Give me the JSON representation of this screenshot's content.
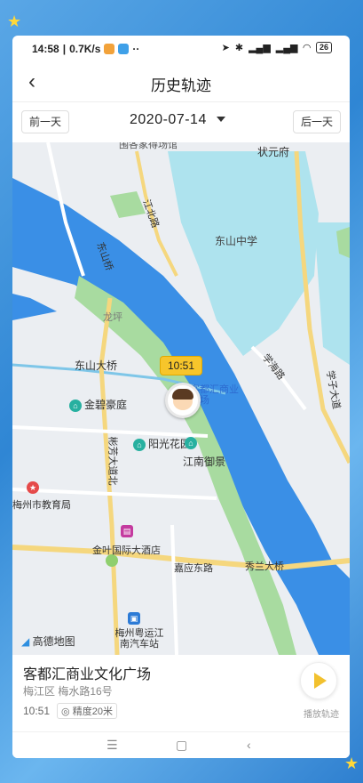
{
  "status": {
    "time": "14:58",
    "speed": "0.7K/s",
    "battery": "26"
  },
  "header": {
    "back_glyph": "‹",
    "title": "历史轨迹"
  },
  "datebar": {
    "prev": "前一天",
    "date": "2020-07-14",
    "next": "后一天"
  },
  "map": {
    "labels": {
      "dongshan_school": "东山中学",
      "zhuangyuanfu": "状元府",
      "jiangbin_road": "江北路",
      "dongshan_bridge_n": "东山桥",
      "dongshan_bridge": "东山大桥",
      "longping": "龙坪",
      "xuehai_road": "学海路",
      "xuezi_ave": "学子大道",
      "jinbihaoting": "金碧豪庭",
      "kedouhui": "客都汇商业广场",
      "biaoqi_ave": "彬芳大道北",
      "yangguang": "阳光花园",
      "jiangnan": "江南御景",
      "education_bureau": "梅州市教育局",
      "jinye_hotel": "金叶国际大酒店",
      "jiayingdong_road": "嘉应东路",
      "xiulan_bridge": "秀兰大桥",
      "bus_station": "梅州粤运江南汽车站",
      "top_partial": "围各家得场馆"
    },
    "time_badge": "10:51",
    "logo": "高德地图",
    "colors": {
      "river": "#3a8fe6",
      "lake": "#aee3ee",
      "road": "#f5d77e",
      "green": "#a8dba0"
    }
  },
  "info": {
    "place": "客都汇商业文化广场",
    "address": "梅江区 梅水路16号",
    "time": "10:51",
    "accuracy": "精度20米",
    "play_label": "播放轨迹"
  },
  "nav": {
    "menu": "☰",
    "home": "▢",
    "back": "‹"
  }
}
